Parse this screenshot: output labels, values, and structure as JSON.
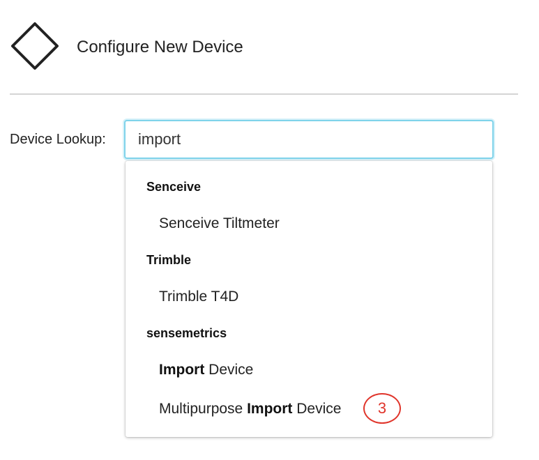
{
  "header": {
    "title": "Configure New Device",
    "icon": "diamond-icon"
  },
  "lookup": {
    "label": "Device Lookup:",
    "value": "import",
    "accent_color": "#7fd3ea"
  },
  "dropdown": {
    "groups": [
      {
        "name": "Senceive",
        "options": [
          {
            "pre": "Senceive Tiltmeter",
            "match": "",
            "post": ""
          }
        ]
      },
      {
        "name": "Trimble",
        "options": [
          {
            "pre": "Trimble T4D",
            "match": "",
            "post": ""
          }
        ]
      },
      {
        "name": "sensemetrics",
        "options": [
          {
            "pre": "",
            "match": "Import",
            "post": " Device"
          },
          {
            "pre": "Multipurpose ",
            "match": "Import",
            "post": " Device"
          }
        ]
      }
    ]
  },
  "annotation": {
    "step_number": "3",
    "color": "#e0352b"
  }
}
